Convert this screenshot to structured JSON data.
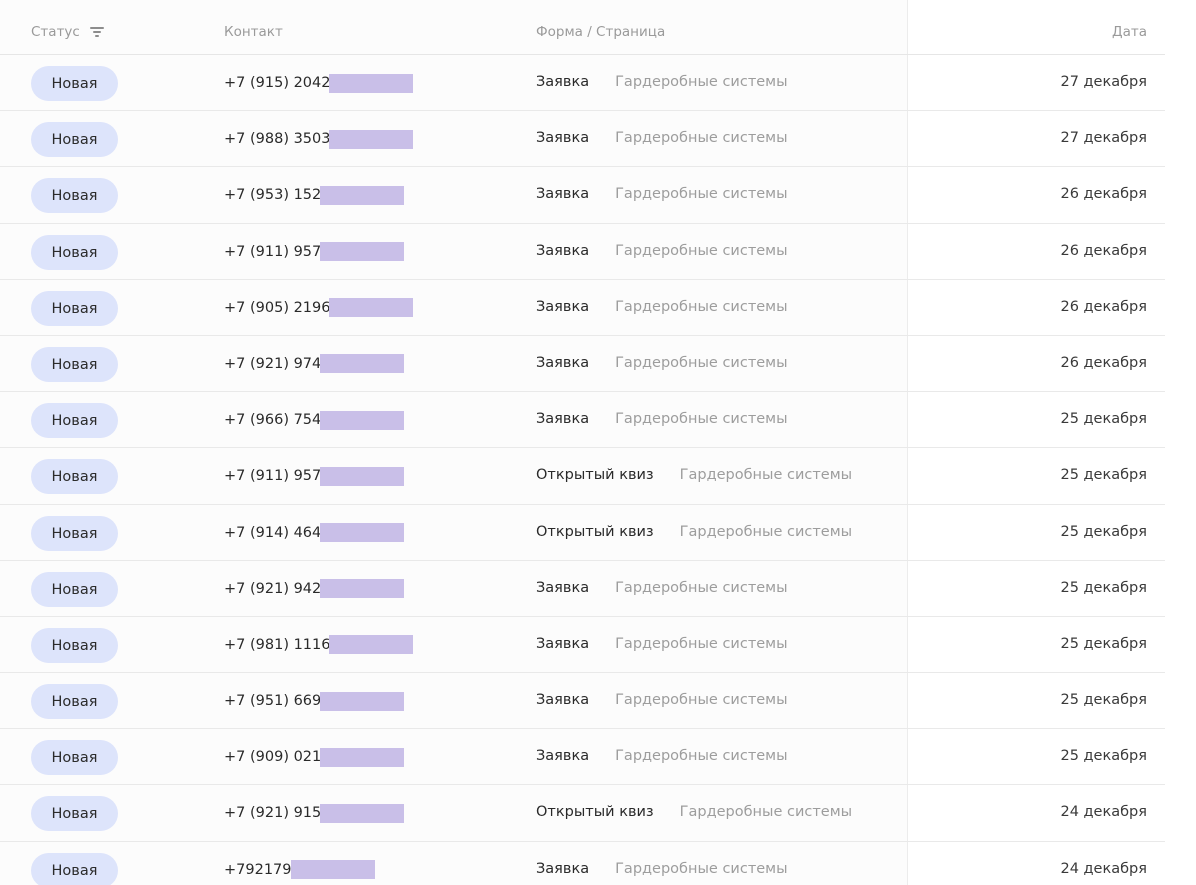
{
  "header": {
    "status": "Статус",
    "contact": "Контакт",
    "form_page": "Форма / Страница",
    "date": "Дата"
  },
  "icons": {
    "status_filter": "filter-icon"
  },
  "colors": {
    "badge_bg": "#dde4fb",
    "redaction": "#c9bfe8",
    "muted_text": "#9d9d9d"
  },
  "rows": [
    {
      "status": "Новая",
      "phone": "+7 (915) 2042",
      "form": "Заявка",
      "page": "Гардеробные системы",
      "date": "27 декабря"
    },
    {
      "status": "Новая",
      "phone": "+7 (988) 3503",
      "form": "Заявка",
      "page": "Гардеробные системы",
      "date": "27 декабря"
    },
    {
      "status": "Новая",
      "phone": "+7 (953) 152",
      "form": "Заявка",
      "page": "Гардеробные системы",
      "date": "26 декабря"
    },
    {
      "status": "Новая",
      "phone": "+7 (911) 957",
      "form": "Заявка",
      "page": "Гардеробные системы",
      "date": "26 декабря"
    },
    {
      "status": "Новая",
      "phone": "+7 (905) 2196",
      "form": "Заявка",
      "page": "Гардеробные системы",
      "date": "26 декабря"
    },
    {
      "status": "Новая",
      "phone": "+7 (921) 974",
      "form": "Заявка",
      "page": "Гардеробные системы",
      "date": "26 декабря"
    },
    {
      "status": "Новая",
      "phone": "+7 (966) 754",
      "form": "Заявка",
      "page": "Гардеробные системы",
      "date": "25 декабря"
    },
    {
      "status": "Новая",
      "phone": "+7 (911) 957",
      "form": "Открытый квиз",
      "page": "Гардеробные системы",
      "date": "25 декабря"
    },
    {
      "status": "Новая",
      "phone": "+7 (914) 464",
      "form": "Открытый квиз",
      "page": "Гардеробные системы",
      "date": "25 декабря"
    },
    {
      "status": "Новая",
      "phone": "+7 (921) 942",
      "form": "Заявка",
      "page": "Гардеробные системы",
      "date": "25 декабря"
    },
    {
      "status": "Новая",
      "phone": "+7 (981) 1116",
      "form": "Заявка",
      "page": "Гардеробные системы",
      "date": "25 декабря"
    },
    {
      "status": "Новая",
      "phone": "+7 (951) 669",
      "form": "Заявка",
      "page": "Гардеробные системы",
      "date": "25 декабря"
    },
    {
      "status": "Новая",
      "phone": "+7 (909) 021",
      "form": "Заявка",
      "page": "Гардеробные системы",
      "date": "25 декабря"
    },
    {
      "status": "Новая",
      "phone": "+7 (921) 915",
      "form": "Открытый квиз",
      "page": "Гардеробные системы",
      "date": "24 декабря"
    },
    {
      "status": "Новая",
      "phone": "+792179",
      "form": "Заявка",
      "page": "Гардеробные системы",
      "date": "24 декабря"
    }
  ]
}
